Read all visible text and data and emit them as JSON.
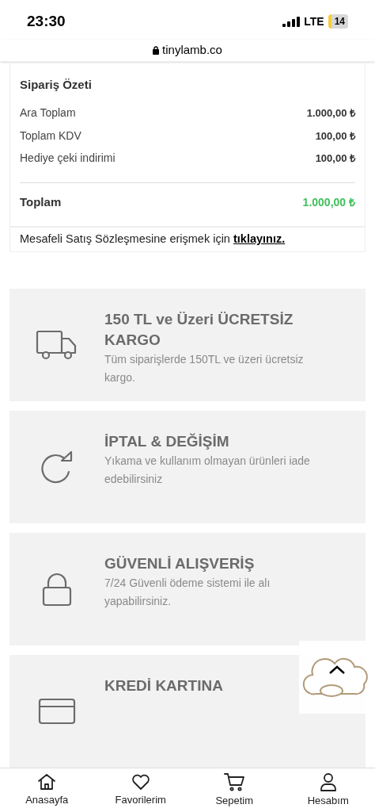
{
  "status_bar": {
    "time": "23:30",
    "network": "LTE",
    "battery": "14"
  },
  "address_bar": {
    "url": "tinylamb.co"
  },
  "order_summary": {
    "title": "Sipariş Özeti",
    "rows": [
      {
        "label": "Ara Toplam",
        "value": "1.000,00 ₺"
      },
      {
        "label": "Toplam KDV",
        "value": "100,00 ₺"
      },
      {
        "label": "Hediye çeki indirimi",
        "value": "100,00 ₺"
      }
    ],
    "total": {
      "label": "Toplam",
      "value": "1.000,00 ₺"
    }
  },
  "contract": {
    "text": "Mesafeli Satış Sözleşmesine erişmek için",
    "link": "tıklayınız."
  },
  "features": [
    {
      "kind": "truck",
      "title": "150 TL ve Üzeri ÜCRETSİZ KARGO",
      "description": "Tüm siparişlerde 150TL ve üzeri ücretsiz kargo."
    },
    {
      "kind": "refresh",
      "title": "İPTAL & DEĞİŞİM",
      "description": "Yıkama ve kullanım olmayan ürünleri iade edebilirsiniz"
    },
    {
      "kind": "lock",
      "title": "GÜVENLİ ALIŞVERİŞ",
      "description": "7/24 Güvenli ödeme sistemi ile alı",
      "description_2": "yapabilirsiniz."
    },
    {
      "kind": "card",
      "title": "KREDİ KARTINA"
    }
  ],
  "bottom_nav": [
    {
      "kind": "home",
      "label": "Anasayfa"
    },
    {
      "kind": "heart",
      "label": "Favorilerim"
    },
    {
      "kind": "cart",
      "label": "Sepetim"
    },
    {
      "kind": "user",
      "label": "Hesabım"
    }
  ]
}
